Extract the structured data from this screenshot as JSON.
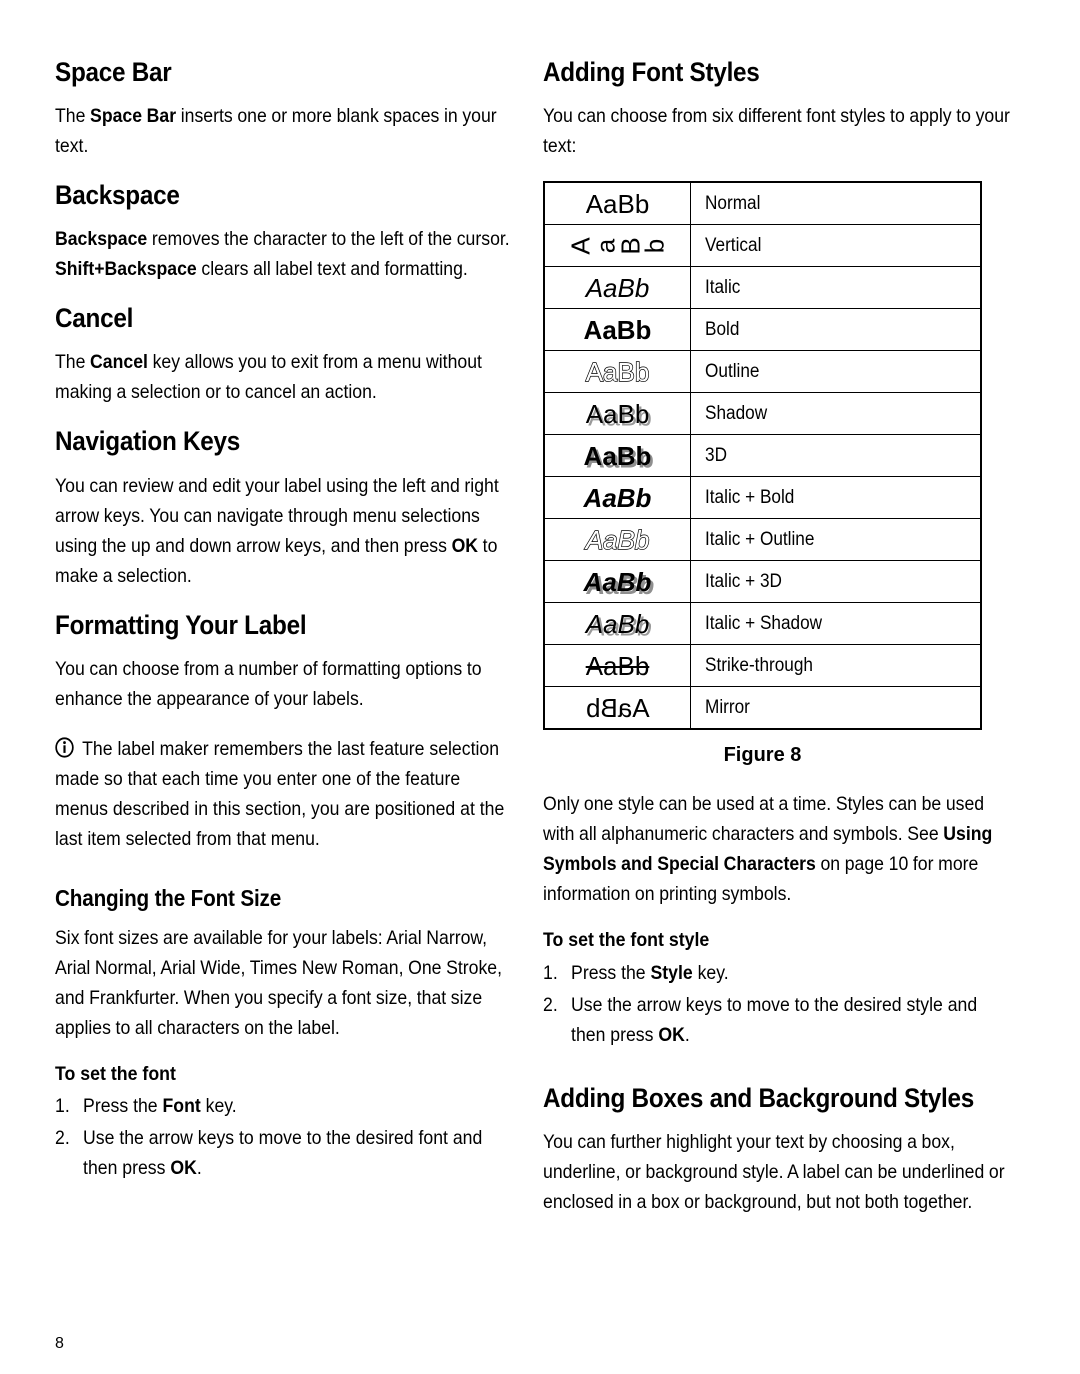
{
  "page": {
    "number": "8"
  },
  "left_column": {
    "space_bar": {
      "heading": "Space Bar",
      "body_1": "The ",
      "body_bold": "Space Bar",
      "body_2": " inserts one or more blank spaces in your text."
    },
    "backspace": {
      "heading": "Backspace",
      "bold_1": "Backspace",
      "text_1": " removes the character to the left of the cursor. ",
      "bold_2": "Shift+Backspace",
      "text_2": " clears all label text and formatting."
    },
    "cancel": {
      "heading": "Cancel",
      "text_1": "The ",
      "bold_1": "Cancel",
      "text_2": " key allows you to exit from a menu without making a selection or to cancel an action."
    },
    "navigation_keys": {
      "heading": "Navigation Keys",
      "text_1": "You can review and edit your label using the left and right arrow keys. You can navigate through menu selections using the up and down arrow keys, and then press ",
      "bold_1": "OK",
      "text_2": " to make a selection."
    },
    "formatting": {
      "heading": "Formatting Your Label",
      "body": "You can choose from a number of formatting options to enhance the appearance of your labels.",
      "note_icon": "info-icon",
      "note": "The label maker remembers the last feature selection made so that each time you enter one of the feature menus described in this section, you are positioned at the last item selected from that menu."
    },
    "font_size": {
      "heading": "Changing the Font Size",
      "body": "Six font sizes are available for your labels: Arial Narrow, Arial Normal, Arial Wide, Times New Roman, One Stroke, and Frankfurter. When you specify a font size, that size applies to all characters on the label.",
      "procedure_heading": "To set the font",
      "steps": [
        {
          "num": "1.",
          "text_1": "Press the ",
          "bold_1": "Font",
          "text_2": " key."
        },
        {
          "num": "2.",
          "text_1": "Use the arrow keys to move to the desired font and then press ",
          "bold_1": "OK",
          "text_2": "."
        }
      ]
    }
  },
  "right_column": {
    "font_styles": {
      "heading": "Adding Font Styles",
      "intro": "You can choose from six different font styles to apply to your text:",
      "figure_caption": "Figure 8",
      "table_rows": [
        {
          "sample": "AaBb",
          "style": "normal",
          "label": "Normal"
        },
        {
          "sample": "AaBb",
          "style": "vertical",
          "label": "Vertical"
        },
        {
          "sample": "AaBb",
          "style": "italic",
          "label": "Italic"
        },
        {
          "sample": "AaBb",
          "style": "bold",
          "label": "Bold"
        },
        {
          "sample": "AaBb",
          "style": "outline",
          "label": "Outline"
        },
        {
          "sample": "AaBb",
          "style": "shadow",
          "label": "Shadow"
        },
        {
          "sample": "AaBb",
          "style": "3d",
          "label": "3D"
        },
        {
          "sample": "AaBb",
          "style": "italic-bold",
          "label": "Italic + Bold"
        },
        {
          "sample": "AaBb",
          "style": "italic-outline",
          "label": "Italic + Outline"
        },
        {
          "sample": "AaBb",
          "style": "italic-3d",
          "label": "Italic + 3D"
        },
        {
          "sample": "AaBb",
          "style": "italic-shadow",
          "label": "Italic + Shadow"
        },
        {
          "sample": "AaBb",
          "style": "strike",
          "label": "Strike-through"
        },
        {
          "sample": "AaBb",
          "style": "mirror",
          "label": "Mirror"
        }
      ],
      "after_text_1": "Only one style can be used at a time. Styles can be used with all alphanumeric characters and symbols. See ",
      "after_bold": "Using Symbols and Special Characters",
      "after_text_2": " on page 10 for more information on printing symbols.",
      "procedure_heading": "To set the font style",
      "steps": [
        {
          "num": "1.",
          "text_1": "Press the ",
          "bold_1": "Style",
          "text_2": " key."
        },
        {
          "num": "2.",
          "text_1": "Use the arrow keys to move to the desired style and then press ",
          "bold_1": "OK",
          "text_2": "."
        }
      ]
    },
    "boxes_backgrounds": {
      "heading": "Adding Boxes and Background Styles",
      "body": "You can further highlight your text by choosing a box, underline, or background style. A label can be underlined or enclosed in a box or background, but not both together."
    }
  }
}
